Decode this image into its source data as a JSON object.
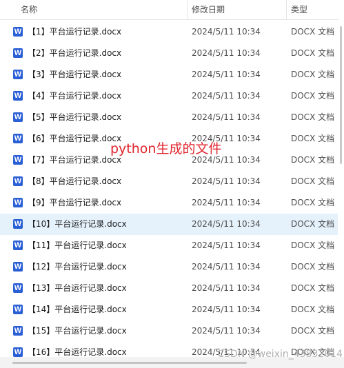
{
  "columns": {
    "name": "名称",
    "date": "修改日期",
    "type": "类型"
  },
  "files": [
    {
      "name": "【1】平台运行记录.docx",
      "date": "2024/5/11 10:34",
      "type": "DOCX 文档"
    },
    {
      "name": "【2】平台运行记录.docx",
      "date": "2024/5/11 10:34",
      "type": "DOCX 文档"
    },
    {
      "name": "【3】平台运行记录.docx",
      "date": "2024/5/11 10:34",
      "type": "DOCX 文档"
    },
    {
      "name": "【4】平台运行记录.docx",
      "date": "2024/5/11 10:34",
      "type": "DOCX 文档"
    },
    {
      "name": "【5】平台运行记录.docx",
      "date": "2024/5/11 10:34",
      "type": "DOCX 文档"
    },
    {
      "name": "【6】平台运行记录.docx",
      "date": "2024/5/11 10:34",
      "type": "DOCX 文档"
    },
    {
      "name": "【7】平台运行记录.docx",
      "date": "2024/5/11 10:34",
      "type": "DOCX 文档"
    },
    {
      "name": "【8】平台运行记录.docx",
      "date": "2024/5/11 10:34",
      "type": "DOCX 文档"
    },
    {
      "name": "【9】平台运行记录.docx",
      "date": "2024/5/11 10:34",
      "type": "DOCX 文档"
    },
    {
      "name": "【10】平台运行记录.docx",
      "date": "2024/5/11 10:34",
      "type": "DOCX 文档",
      "selected": true
    },
    {
      "name": "【11】平台运行记录.docx",
      "date": "2024/5/11 10:34",
      "type": "DOCX 文档"
    },
    {
      "name": "【12】平台运行记录.docx",
      "date": "2024/5/11 10:34",
      "type": "DOCX 文档"
    },
    {
      "name": "【13】平台运行记录.docx",
      "date": "2024/5/11 10:34",
      "type": "DOCX 文档"
    },
    {
      "name": "【14】平台运行记录.docx",
      "date": "2024/5/11 10:34",
      "type": "DOCX 文档"
    },
    {
      "name": "【15】平台运行记录.docx",
      "date": "2024/5/11 10:34",
      "type": "DOCX 文档"
    },
    {
      "name": "【16】平台运行记录.docx",
      "date": "2024/5/11 10:34",
      "type": "DOCX 文档"
    }
  ],
  "file_icon": {
    "name": "word-doc-icon",
    "glyph": "W",
    "color": "#2b5fd6"
  },
  "selection_color": "#e5f1fb",
  "annotation": {
    "text": "python生成的文件",
    "color": "#e0242c"
  },
  "watermark": "CSDN @weixin_43832014"
}
